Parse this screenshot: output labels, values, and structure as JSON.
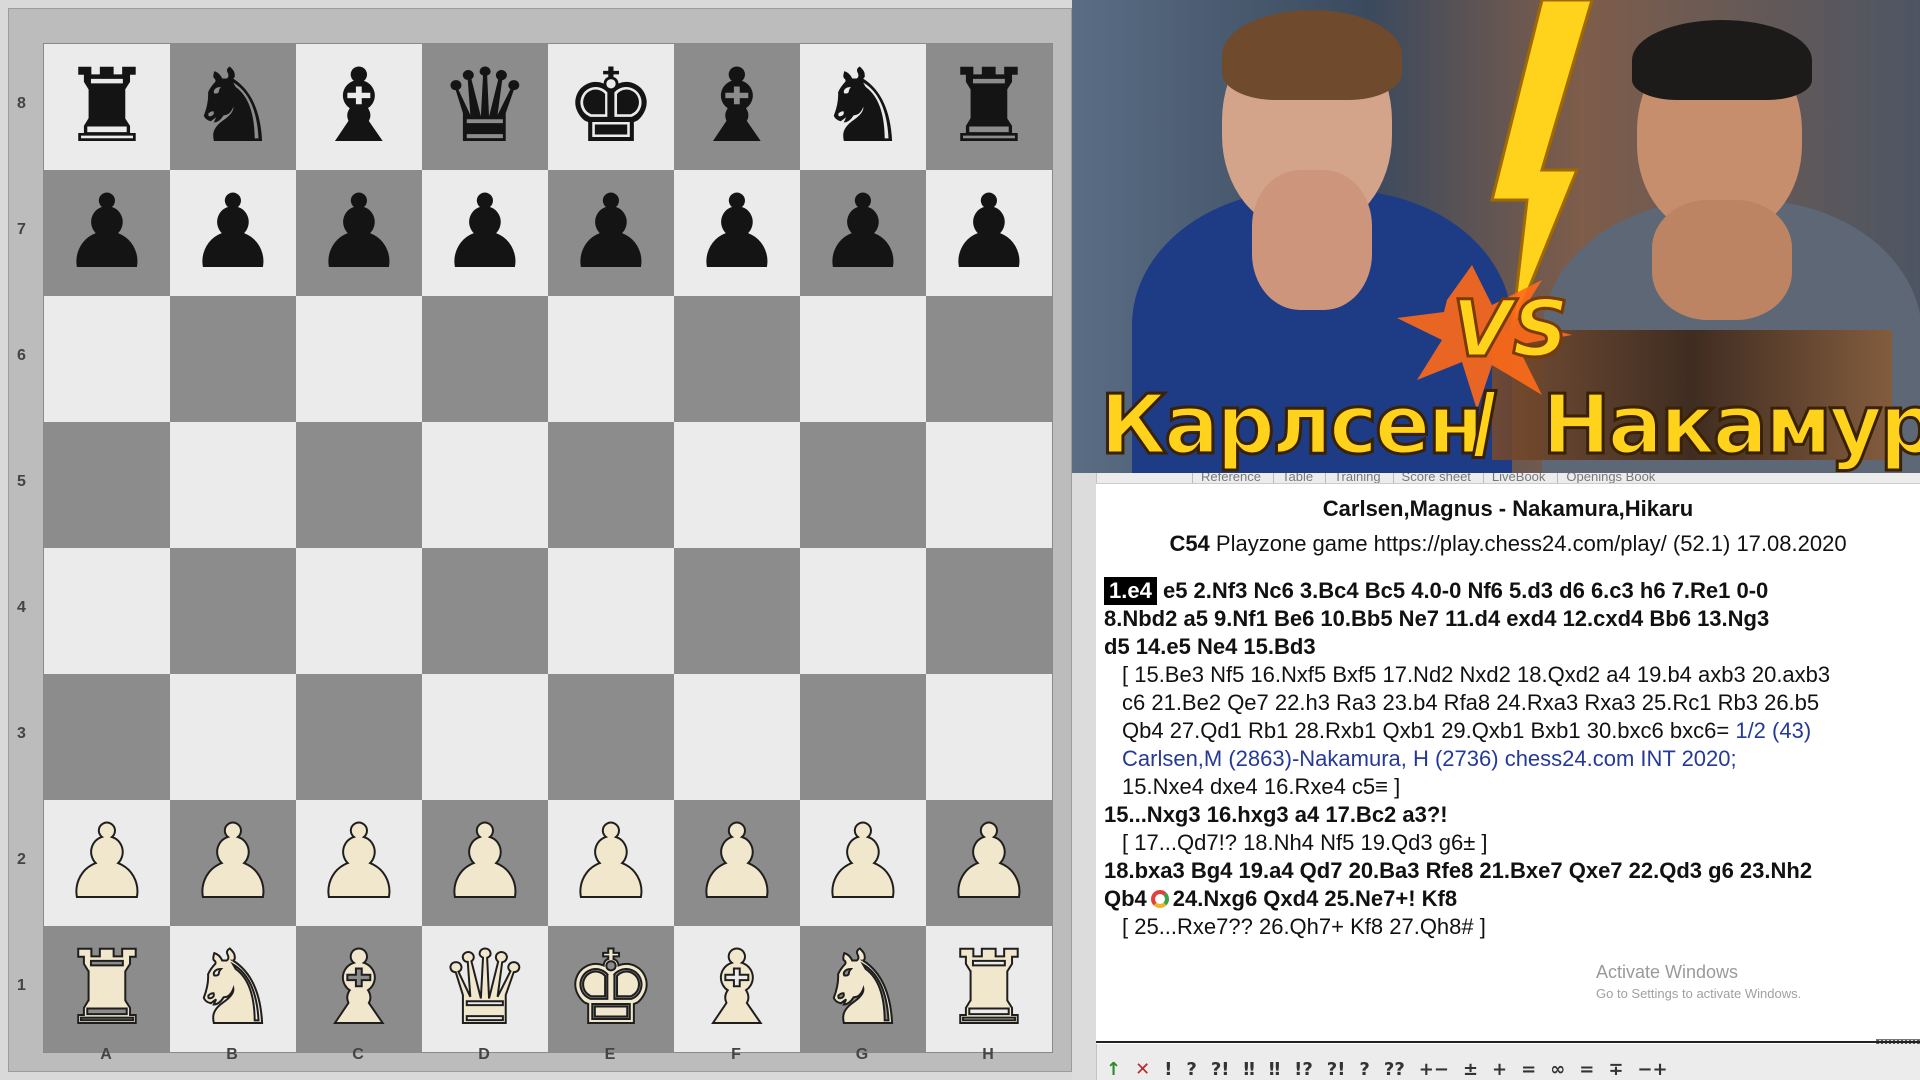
{
  "board": {
    "files": [
      "A",
      "B",
      "C",
      "D",
      "E",
      "F",
      "G",
      "H"
    ],
    "ranks": [
      "8",
      "7",
      "6",
      "5",
      "4",
      "3",
      "2",
      "1"
    ],
    "position": [
      [
        "br",
        "bn",
        "bb",
        "bq",
        "bk",
        "bb",
        "bn",
        "br"
      ],
      [
        "bp",
        "bp",
        "bp",
        "bp",
        "bp",
        "bp",
        "bp",
        "bp"
      ],
      [
        "",
        "",
        "",
        "",
        "",
        "",
        "",
        ""
      ],
      [
        "",
        "",
        "",
        "",
        "",
        "",
        "",
        ""
      ],
      [
        "",
        "",
        "",
        "",
        "",
        "",
        "",
        ""
      ],
      [
        "",
        "",
        "",
        "",
        "",
        "",
        "",
        ""
      ],
      [
        "wp",
        "wp",
        "wp",
        "wp",
        "wp",
        "wp",
        "wp",
        "wp"
      ],
      [
        "wr",
        "wn",
        "wb",
        "wq",
        "wk",
        "wb",
        "wn",
        "wr"
      ]
    ]
  },
  "thumbnail": {
    "left_name": "Карлсен",
    "right_name": "Накамура",
    "vs": "VS",
    "accent_color": "#ffd21c"
  },
  "tabs": [
    "Reference",
    "Table",
    "Training",
    "Score sheet",
    "LiveBook",
    "Openings Book"
  ],
  "header": {
    "title": "Carlsen,Magnus - Nakamura,Hikaru",
    "eco": "C54",
    "info": "Playzone game https://play.chess24.com/play/ (52.1) 17.08.2020"
  },
  "notation": {
    "current_move": "1.e4",
    "line1_rest": "e5  2.Nf3  Nc6  3.Bc4  Bc5  4.0-0  Nf6  5.d3  d6  6.c3  h6  7.Re1  0-0",
    "line2": "8.Nbd2  a5  9.Nf1  Be6  10.Bb5  Ne7  11.d4  exd4  12.cxd4  Bb6  13.Ng3",
    "line3": "d5  14.e5  Ne4  15.Bd3",
    "var1_l1": "[ 15.Be3  Nf5  16.Nxf5  Bxf5  17.Nd2  Nxd2  18.Qxd2  a4  19.b4  axb3  20.axb3",
    "var1_l2": "c6  21.Be2  Qe7  22.h3  Ra3  23.b4  Rfa8  24.Rxa3  Rxa3  25.Rc1  Rb3  26.b5",
    "var1_l3_moves": "Qb4  27.Qd1  Rb1  28.Rxb1  Qxb1  29.Qxb1  Bxb1  30.bxc6  bxc6= ",
    "var1_l3_ref": "1/2 (43)",
    "var1_l4_ref": "Carlsen,M (2863)-Nakamura, H (2736) chess24.com INT 2020;",
    "var1_l5": "15.Nxe4  dxe4  16.Rxe4  c5≡ ]",
    "line4": "15...Nxg3  16.hxg3  a4  17.Bc2  a3?!",
    "var2": "[ 17...Qd7!?  18.Nh4  Nf5  19.Qd3  g6± ]",
    "line5": "18.bxa3  Bg4  19.a4  Qd7  20.Ba3  Rfe8  21.Bxe7  Qxe7  22.Qd3  g6  23.Nh2",
    "line6_a": "Qb4",
    "line6_b": "24.Nxg6  Qxd4  25.Ne7+!  Kf8",
    "var3": "[ 25...Rxe7??  26.Qh7+  Kf8  27.Qh8# ]"
  },
  "overlay": {
    "activate_title": "Activate Windows",
    "activate_sub": "Go to Settings to activate Windows."
  },
  "toolbar": [
    "↑",
    "✕",
    "!",
    "?",
    "?!",
    "‼",
    "‼",
    "!?",
    "?!",
    "?",
    "??",
    "+−",
    "±",
    "+",
    "=",
    "∞",
    "=",
    "∓",
    "−+"
  ]
}
